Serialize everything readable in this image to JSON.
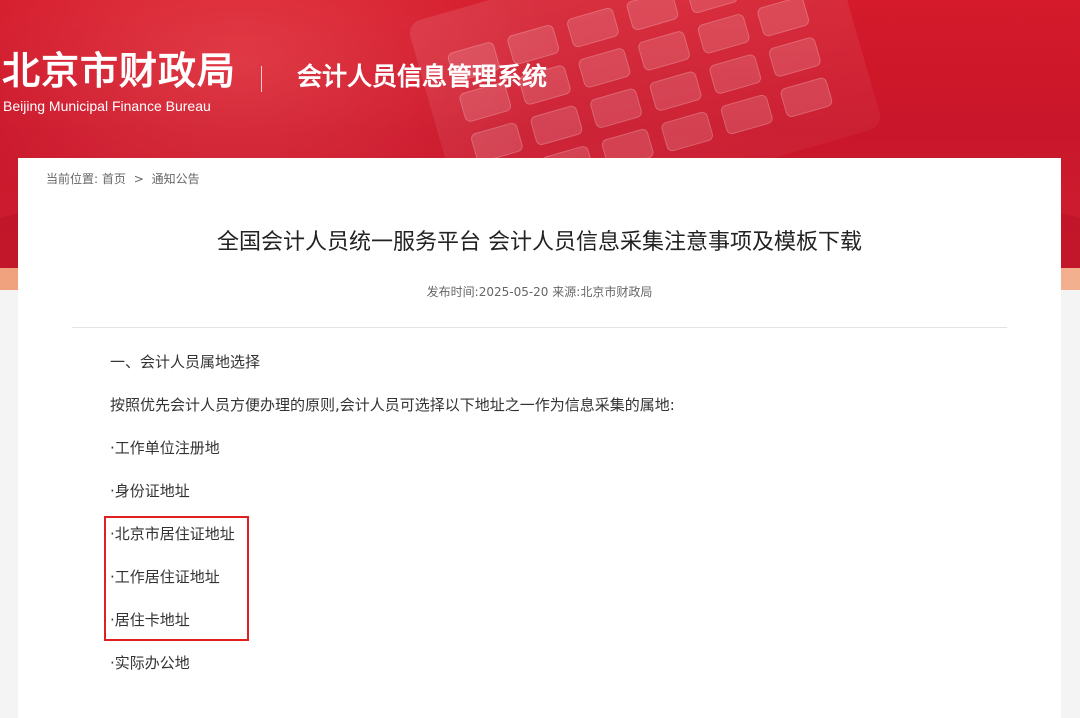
{
  "header": {
    "org_name_cn": "北京市财政局",
    "org_name_en": "Beijing Municipal Finance Bureau",
    "system_title": "会计人员信息管理系统"
  },
  "breadcrumb": {
    "label": "当前位置:",
    "items": [
      "首页",
      "通知公告"
    ],
    "separator": ">"
  },
  "article": {
    "title": "全国会计人员统一服务平台 会计人员信息采集注意事项及模板下载",
    "publish_label": "发布时间:",
    "publish_date": "2025-05-20",
    "source_label": "来源:",
    "source": "北京市财政局",
    "section_heading": "一、会计人员属地选择",
    "intro": "按照优先会计人员方便办理的原则,会计人员可选择以下地址之一作为信息采集的属地:",
    "items": [
      "·工作单位注册地",
      "·身份证地址",
      "·北京市居住证地址",
      "·工作居住证地址",
      "·居住卡地址",
      "·实际办公地"
    ]
  },
  "colors": {
    "banner_red": "#c9162a",
    "highlight_border": "#e02020"
  }
}
